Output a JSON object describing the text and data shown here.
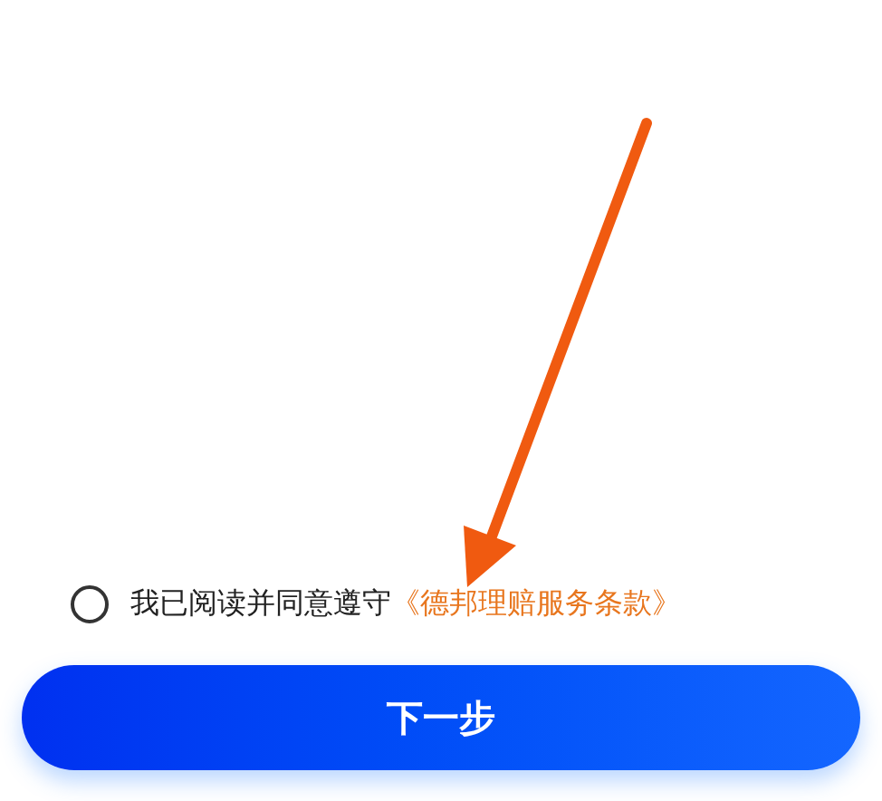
{
  "agreement": {
    "checked": false,
    "text": "我已阅读并同意遵守",
    "link": "《德邦理赔服务条款》"
  },
  "next_button": {
    "label": "下一步"
  }
}
